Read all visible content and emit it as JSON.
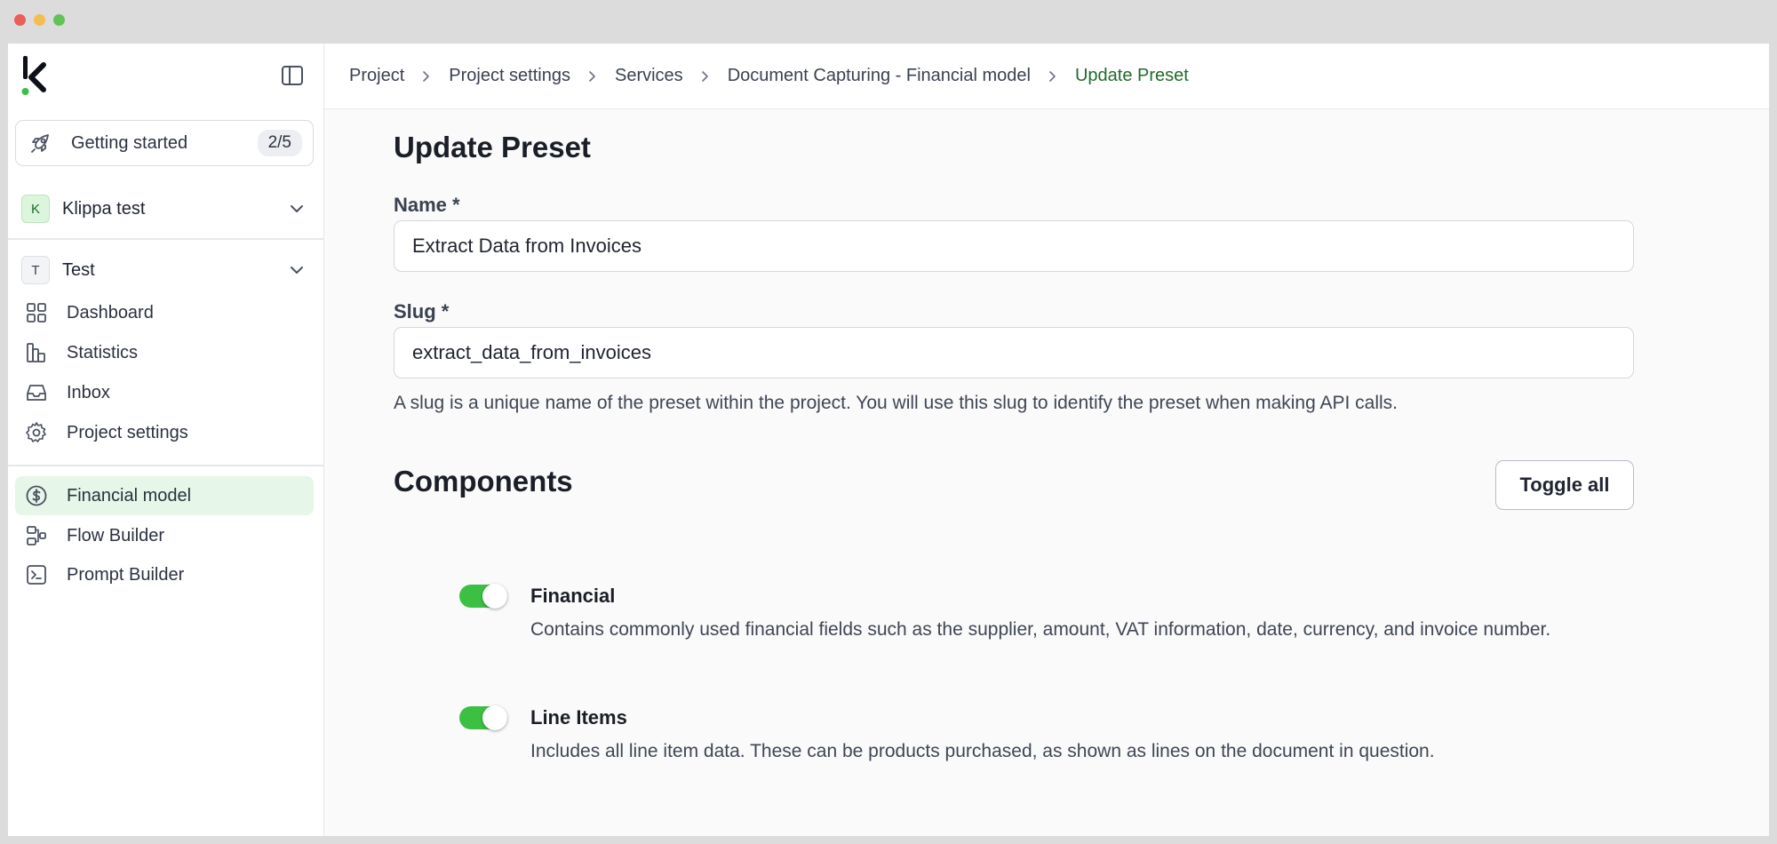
{
  "sidebar": {
    "getting_started": {
      "label": "Getting started",
      "progress": "2/5"
    },
    "organization": {
      "avatar": "K",
      "name": "Klippa test"
    },
    "project": {
      "avatar": "T",
      "name": "Test"
    },
    "project_nav": [
      {
        "label": "Dashboard",
        "icon": "dashboard-grid-icon"
      },
      {
        "label": "Statistics",
        "icon": "statistics-chart-icon"
      },
      {
        "label": "Inbox",
        "icon": "inbox-tray-icon"
      },
      {
        "label": "Project settings",
        "icon": "gear-icon"
      }
    ],
    "service_nav": [
      {
        "label": "Financial model",
        "icon": "dollar-circle-icon",
        "active": true
      },
      {
        "label": "Flow Builder",
        "icon": "flow-builder-icon"
      },
      {
        "label": "Prompt Builder",
        "icon": "terminal-icon"
      }
    ]
  },
  "breadcrumb": [
    "Project",
    "Project settings",
    "Services",
    "Document Capturing - Financial model",
    "Update Preset"
  ],
  "page": {
    "title": "Update Preset",
    "name_label": "Name *",
    "name_value": "Extract Data from Invoices",
    "slug_label": "Slug *",
    "slug_value": "extract_data_from_invoices",
    "slug_help": "A slug is a unique name of the preset within the project. You will use this slug to identify the preset when making API calls.",
    "components_title": "Components",
    "toggle_all_label": "Toggle all",
    "components": [
      {
        "name": "Financial",
        "enabled": true,
        "description": "Contains commonly used financial fields such as the supplier, amount, VAT information, date, currency, and invoice number."
      },
      {
        "name": "Line Items",
        "enabled": true,
        "description": "Includes all line item data. These can be products purchased, as shown as lines on the document in question."
      }
    ]
  },
  "colors": {
    "accent_green": "#3cc043",
    "active_bg": "#e6f6e8",
    "current_crumb": "#1f6b2a"
  }
}
